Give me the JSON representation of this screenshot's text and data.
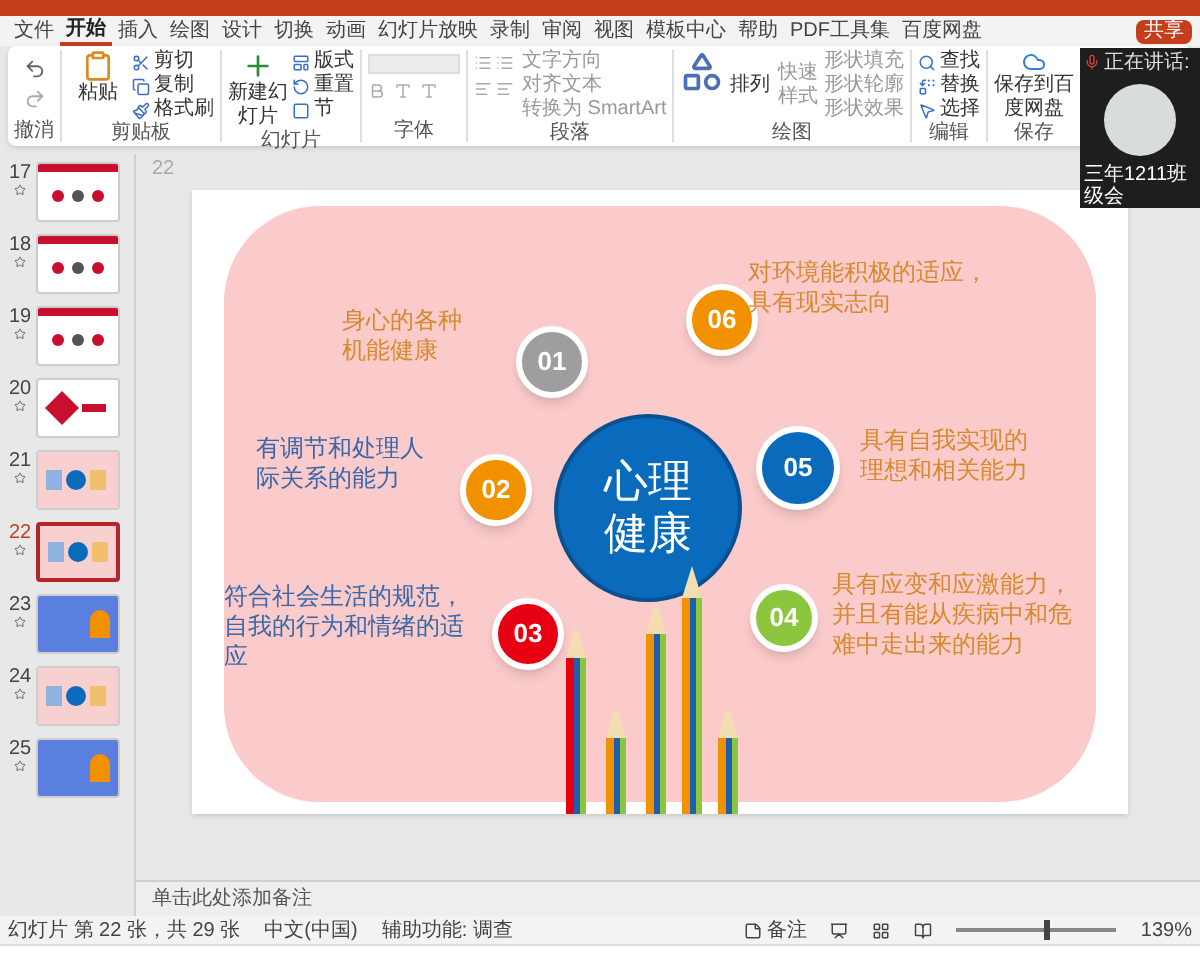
{
  "share_button": "共享",
  "tabs": [
    {
      "label": "文件",
      "selected": false
    },
    {
      "label": "开始",
      "selected": true
    },
    {
      "label": "插入",
      "selected": false
    },
    {
      "label": "绘图",
      "selected": false
    },
    {
      "label": "设计",
      "selected": false
    },
    {
      "label": "切换",
      "selected": false
    },
    {
      "label": "动画",
      "selected": false
    },
    {
      "label": "幻灯片放映",
      "selected": false
    },
    {
      "label": "录制",
      "selected": false
    },
    {
      "label": "审阅",
      "selected": false
    },
    {
      "label": "视图",
      "selected": false
    },
    {
      "label": "模板中心",
      "selected": false
    },
    {
      "label": "帮助",
      "selected": false
    },
    {
      "label": "PDF工具集",
      "selected": false
    },
    {
      "label": "百度网盘",
      "selected": false
    }
  ],
  "ribbon": [
    {
      "label": "撤消",
      "kind": "undo"
    },
    {
      "label": "剪贴板",
      "kind": "clipboard",
      "items": [
        "粘贴",
        "剪切",
        "复制",
        "格式刷"
      ]
    },
    {
      "label": "幻灯片",
      "kind": "slides",
      "items": [
        "新建幻灯片",
        "版式",
        "重置",
        "节"
      ]
    },
    {
      "label": "字体",
      "kind": "font"
    },
    {
      "label": "段落",
      "kind": "paragraph",
      "items": [
        "文字方向",
        "对齐文本",
        "转换为 SmartArt"
      ]
    },
    {
      "label": "绘图",
      "kind": "drawing",
      "items": [
        "排列",
        "快速样式",
        "形状填充",
        "形状轮廓",
        "形状效果"
      ]
    },
    {
      "label": "编辑",
      "kind": "editing",
      "items": [
        "查找",
        "替换",
        "选择"
      ]
    },
    {
      "label": "保存",
      "kind": "save",
      "items": [
        "保存到百度网盘"
      ]
    }
  ],
  "meeting": {
    "status": "正在讲话:",
    "name": "三年1211班级会"
  },
  "thumbnails": [
    {
      "number": "17",
      "kind": "report",
      "selected": false
    },
    {
      "number": "18",
      "kind": "report",
      "selected": false
    },
    {
      "number": "19",
      "kind": "report",
      "selected": false
    },
    {
      "number": "20",
      "kind": "title",
      "selected": false
    },
    {
      "number": "21",
      "kind": "pink",
      "selected": false
    },
    {
      "number": "22",
      "kind": "pink",
      "selected": true
    },
    {
      "number": "23",
      "kind": "blue",
      "selected": false
    },
    {
      "number": "24",
      "kind": "pink",
      "selected": false
    },
    {
      "number": "25",
      "kind": "blue",
      "selected": false
    }
  ],
  "slide_number": "22",
  "slide": {
    "center": "心理健康",
    "items": [
      {
        "number": "06",
        "color": "#f29100",
        "kind": "orange",
        "text": "对环境能积极的适应，具有现实志向"
      },
      {
        "number": "01",
        "color": "#9e9e9e",
        "kind": "orange",
        "text": "身心的各种机能健康"
      },
      {
        "number": "02",
        "color": "#f29100",
        "kind": "blue",
        "text": "有调节和处理人际关系的能力"
      },
      {
        "number": "05",
        "color": "#0a6bbd",
        "kind": "orange",
        "text": "具有自我实现的理想和相关能力"
      },
      {
        "number": "03",
        "color": "#e60012",
        "kind": "blue",
        "text": "符合社会生活的规范，自我的行为和情绪的适应"
      },
      {
        "number": "04",
        "color": "#8cc63f",
        "kind": "orange",
        "text": "具有应变和应激能力，并且有能从疾病中和危难中走出来的能力"
      }
    ]
  },
  "notes_placeholder": "单击此处添加备注",
  "status_bar": {
    "slide_info": "幻灯片 第 22 张，共 29 张",
    "language": "中文(中国)",
    "accessibility": "辅助功能: 调查",
    "notes": "备注",
    "zoom": "139%",
    "zoom_level": {
      "level": 0.55
    }
  }
}
